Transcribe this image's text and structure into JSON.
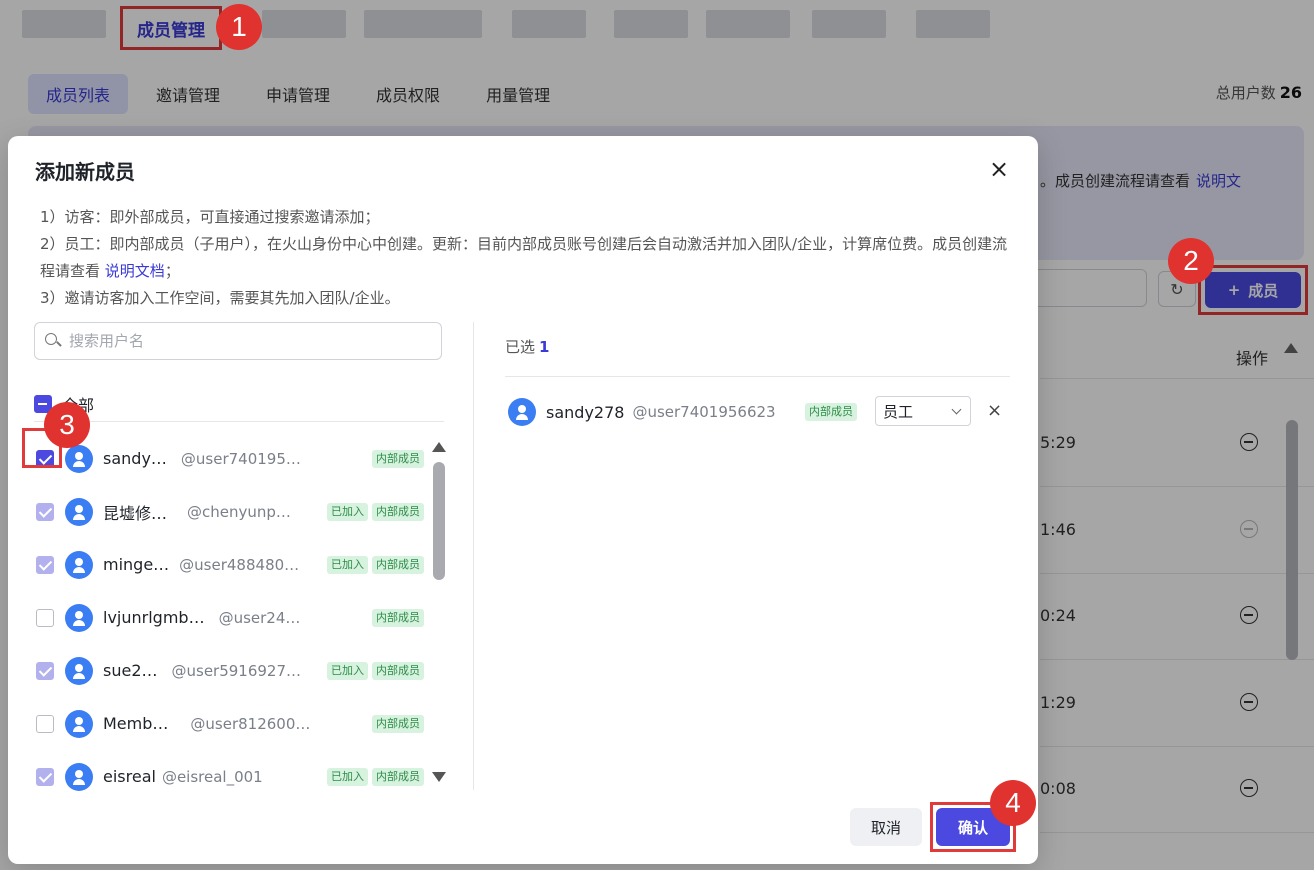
{
  "top_nav": {
    "active_tab": "成员管理"
  },
  "sub_tabs": [
    {
      "label": "成员列表",
      "active": true
    },
    {
      "label": "邀请管理",
      "active": false
    },
    {
      "label": "申请管理",
      "active": false
    },
    {
      "label": "成员权限",
      "active": false
    },
    {
      "label": "用量管理",
      "active": false
    }
  ],
  "stats": {
    "total_users_label": "总用户数",
    "total_users_value": "26"
  },
  "background": {
    "notice_tail": "。成员创建流程请查看",
    "notice_link": "说明文",
    "add_member_label": "成员",
    "actions_header": "操作",
    "rows": [
      {
        "time": "5:29",
        "remove_enabled": true
      },
      {
        "time": "1:46",
        "remove_enabled": false
      },
      {
        "time": "0:24",
        "remove_enabled": true
      },
      {
        "time": "1:29",
        "remove_enabled": true
      },
      {
        "time": "0:08",
        "remove_enabled": true
      }
    ]
  },
  "modal": {
    "title": "添加新成员",
    "desc_line1": "1）访客：即外部成员，可直接通过搜索邀请添加；",
    "desc_line2": "2）员工：即内部成员（子用户），在火山身份中心中创建。更新：目前内部成员账号创建后会自动激活并加入团队/企业，计算席位费。成员创建流程请查看",
    "desc_link": "说明文档",
    "desc_line2_tail": "；",
    "desc_line3": "3）邀请访客加入工作空间，需要其先加入团队/企业。",
    "search_placeholder": "搜索用户名",
    "select_all_label": "全部",
    "users": [
      {
        "name": "sandy…",
        "handle": "@user740195…",
        "tags": [
          "内部成员"
        ],
        "state": "checked"
      },
      {
        "name": "昆墟修…",
        "handle": "@chenyunp…",
        "tags": [
          "已加入",
          "内部成员"
        ],
        "state": "disabled"
      },
      {
        "name": "minge…",
        "handle": "@user488480…",
        "tags": [
          "已加入",
          "内部成员"
        ],
        "state": "disabled"
      },
      {
        "name": "lvjunrlgmb…",
        "handle": "@user24…",
        "tags": [
          "内部成员"
        ],
        "state": "unchecked"
      },
      {
        "name": "sue2…",
        "handle": "@user5916927…",
        "tags": [
          "已加入",
          "内部成员"
        ],
        "state": "disabled"
      },
      {
        "name": "Memb…",
        "handle": "@user812600…",
        "tags": [
          "内部成员"
        ],
        "state": "unchecked"
      },
      {
        "name": "eisreal",
        "handle": "@eisreal_001",
        "tags": [
          "已加入",
          "内部成员"
        ],
        "state": "disabled"
      }
    ],
    "selected_label": "已选",
    "selected_count": "1",
    "selected_user": {
      "name": "sandy278",
      "handle": "@user7401956623",
      "tag": "内部成员",
      "role": "员工"
    },
    "cancel_label": "取消",
    "confirm_label": "确认"
  },
  "step_badges": [
    "1",
    "2",
    "3",
    "4"
  ],
  "colors": {
    "accent": "#4b49e0",
    "highlight_red": "#e03a3a",
    "tag_green_bg": "#d7f2de",
    "tag_green_text": "#2e8c4a",
    "avatar_blue": "#3b7df2"
  }
}
